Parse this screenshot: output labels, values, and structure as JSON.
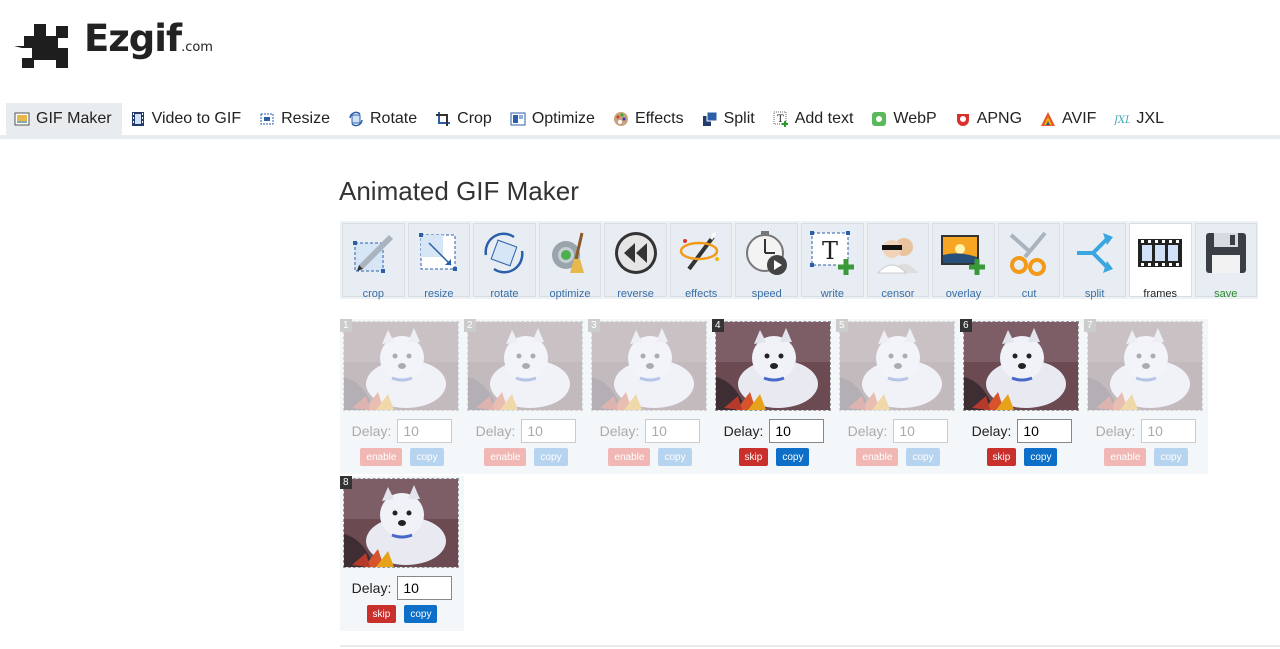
{
  "logo": {
    "text": "Ezgif",
    "tld": ".com"
  },
  "nav": [
    {
      "label": "GIF Maker",
      "icon": "gif-maker-icon",
      "active": true
    },
    {
      "label": "Video to GIF",
      "icon": "film-icon"
    },
    {
      "label": "Resize",
      "icon": "resize-icon"
    },
    {
      "label": "Rotate",
      "icon": "rotate-icon"
    },
    {
      "label": "Crop",
      "icon": "crop-icon"
    },
    {
      "label": "Optimize",
      "icon": "optimize-icon"
    },
    {
      "label": "Effects",
      "icon": "palette-icon"
    },
    {
      "label": "Split",
      "icon": "split-icon"
    },
    {
      "label": "Add text",
      "icon": "add-text-icon"
    },
    {
      "label": "WebP",
      "icon": "webp-icon"
    },
    {
      "label": "APNG",
      "icon": "apng-icon"
    },
    {
      "label": "AVIF",
      "icon": "avif-icon"
    },
    {
      "label": "JXL",
      "icon": "jxl-icon"
    }
  ],
  "page_title": "Animated GIF Maker",
  "tools": [
    {
      "label": "crop"
    },
    {
      "label": "resize"
    },
    {
      "label": "rotate"
    },
    {
      "label": "optimize"
    },
    {
      "label": "reverse"
    },
    {
      "label": "effects"
    },
    {
      "label": "speed"
    },
    {
      "label": "write"
    },
    {
      "label": "censor"
    },
    {
      "label": "overlay"
    },
    {
      "label": "cut"
    },
    {
      "label": "split"
    },
    {
      "label": "frames"
    },
    {
      "label": "save"
    }
  ],
  "delay_label": "Delay:",
  "frames": [
    {
      "num": "1",
      "delay": "10",
      "enabled": false,
      "action": "enable",
      "copy": "copy"
    },
    {
      "num": "2",
      "delay": "10",
      "enabled": false,
      "action": "enable",
      "copy": "copy"
    },
    {
      "num": "3",
      "delay": "10",
      "enabled": false,
      "action": "enable",
      "copy": "copy"
    },
    {
      "num": "4",
      "delay": "10",
      "enabled": true,
      "action": "skip",
      "copy": "copy"
    },
    {
      "num": "5",
      "delay": "10",
      "enabled": false,
      "action": "enable",
      "copy": "copy"
    },
    {
      "num": "6",
      "delay": "10",
      "enabled": true,
      "action": "skip",
      "copy": "copy"
    },
    {
      "num": "7",
      "delay": "10",
      "enabled": false,
      "action": "enable",
      "copy": "copy"
    },
    {
      "num": "8",
      "delay": "10",
      "enabled": true,
      "action": "skip",
      "copy": "copy"
    }
  ]
}
